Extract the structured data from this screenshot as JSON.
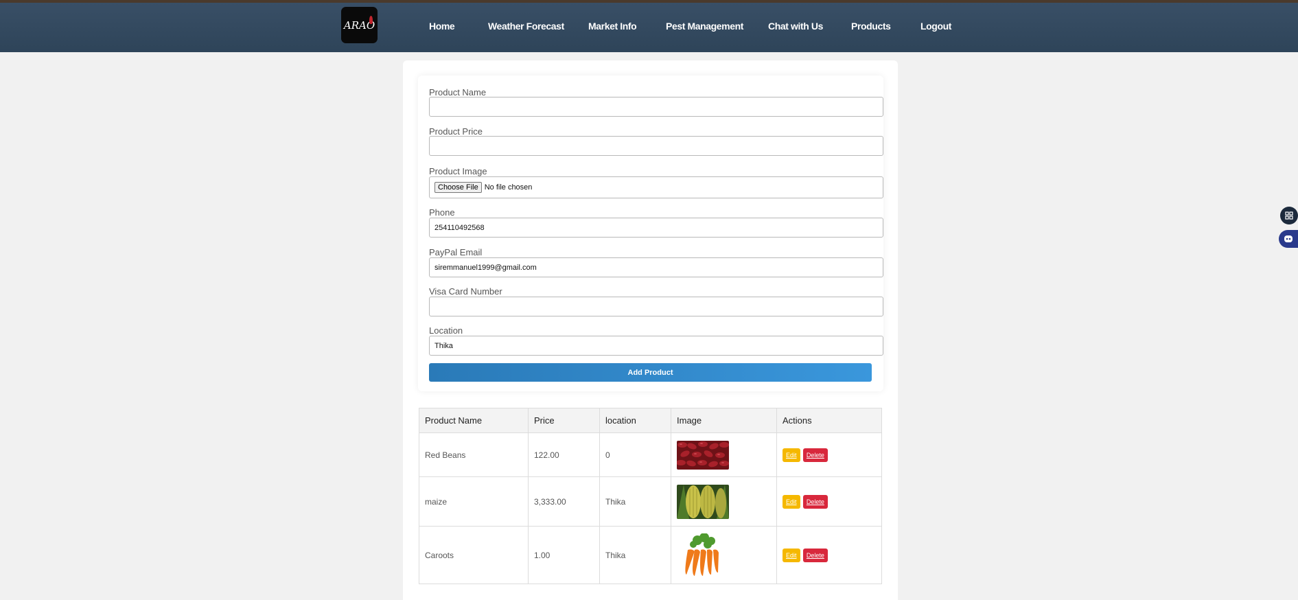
{
  "nav": {
    "logo_text": "ARAO",
    "items": [
      "Home",
      "Weather Forecast",
      "Market Info",
      "Pest Management",
      "Chat with Us",
      "Products",
      "Logout"
    ]
  },
  "form": {
    "product_name": {
      "label": "Product Name",
      "value": ""
    },
    "product_price": {
      "label": "Product Price",
      "value": ""
    },
    "product_image": {
      "label": "Product Image",
      "button": "Choose File",
      "status": "No file chosen"
    },
    "phone": {
      "label": "Phone",
      "value": "254110492568"
    },
    "paypal_email": {
      "label": "PayPal Email",
      "value": "siremmanuel1999@gmail.com"
    },
    "visa_card": {
      "label": "Visa Card Number",
      "value": ""
    },
    "location": {
      "label": "Location",
      "value": "Thika"
    },
    "submit_label": "Add Product"
  },
  "table": {
    "headers": [
      "Product Name",
      "Price",
      "location",
      "Image",
      "Actions"
    ],
    "edit_label": "Edit",
    "delete_label": "Delete",
    "rows": [
      {
        "name": "Red Beans",
        "price": "122.00",
        "location": "0",
        "image": "red-beans"
      },
      {
        "name": "maize",
        "price": "3,333.00",
        "location": "Thika",
        "image": "maize"
      },
      {
        "name": "Caroots",
        "price": "1.00",
        "location": "Thika",
        "image": "carrots"
      }
    ]
  },
  "colors": {
    "navbar": "#34495e",
    "accent": "#3a97dc",
    "edit": "#f5b800",
    "delete": "#d8283c"
  }
}
